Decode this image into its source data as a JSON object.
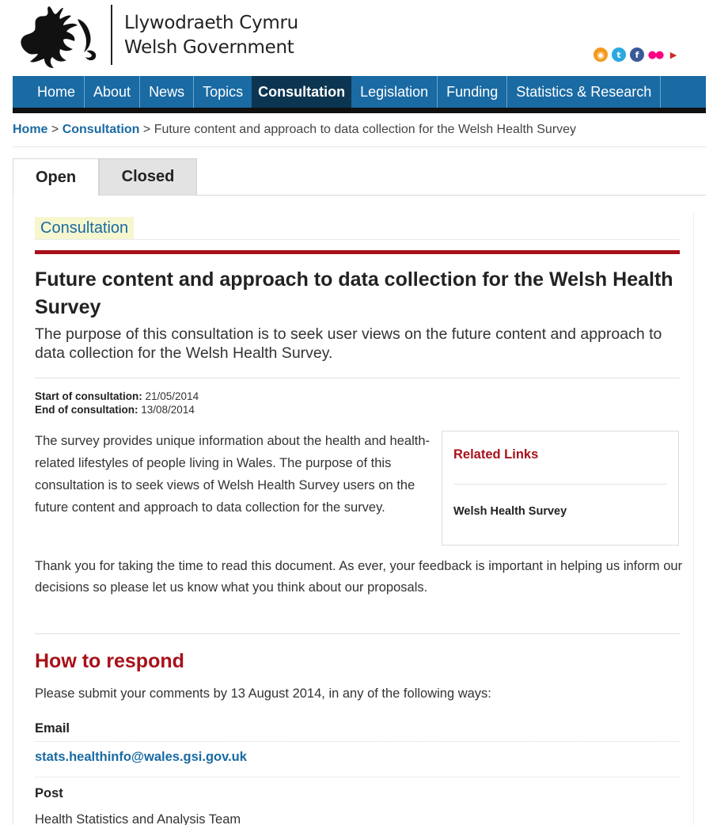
{
  "header": {
    "logo_line1": "Llywodraeth Cymru",
    "logo_line2": "Welsh Government",
    "logo_icon": "red-dragon-logo",
    "social": [
      {
        "name": "rss-icon",
        "glyph": "◉"
      },
      {
        "name": "twitter-icon",
        "glyph": "t"
      },
      {
        "name": "facebook-icon",
        "glyph": "f"
      },
      {
        "name": "flickr-icon",
        "glyph": "●●"
      },
      {
        "name": "youtube-icon",
        "glyph": "▶"
      }
    ]
  },
  "nav": {
    "items": [
      "Home",
      "About",
      "News",
      "Topics",
      "Consultation",
      "Legislation",
      "Funding",
      "Statistics & Research"
    ],
    "active": "Consultation"
  },
  "breadcrumb": {
    "home": "Home",
    "sep1": " > ",
    "section": "Consultation",
    "sep2": " > ",
    "current": "Future content and approach to data collection for the Welsh Health Survey"
  },
  "tabs": {
    "open": "Open",
    "closed": "Closed"
  },
  "main": {
    "badge": "Consultation",
    "title": "Future content and approach to data collection for the Welsh Health Survey",
    "lead": "The purpose of this consultation is to seek user views on the future content and approach to data collection for the Welsh Health Survey.",
    "start_label": "Start of consultation:",
    "start_date": "21/05/2014",
    "end_label": "End of consultation:",
    "end_date": "13/08/2014",
    "para1": "The survey provides unique information about the health and health-related lifestyles of people living in Wales. The purpose of this consultation is to seek views of Welsh Health Survey users on the future content and approach to data collection for the survey.",
    "para2": "Thank you for taking the time to read this document. As ever, your feedback is important in helping us inform our decisions so please let us know what you think about our proposals.",
    "how_to_respond": "How to respond",
    "instruct": "Please submit your comments by 13 August 2014, in any of the following ways:",
    "email_label": "Email",
    "email": "stats.healthinfo@wales.gsi.gov.uk",
    "post_label": "Post",
    "post_line1": "Health Statistics and Analysis Team"
  },
  "related": {
    "title": "Related Links",
    "link": "Welsh Health Survey"
  },
  "colors": {
    "nav_blue": "#1a6aa3",
    "nav_active": "#0c3552",
    "accent_red": "#a8111a",
    "badge_bg": "#f6f6cf"
  }
}
